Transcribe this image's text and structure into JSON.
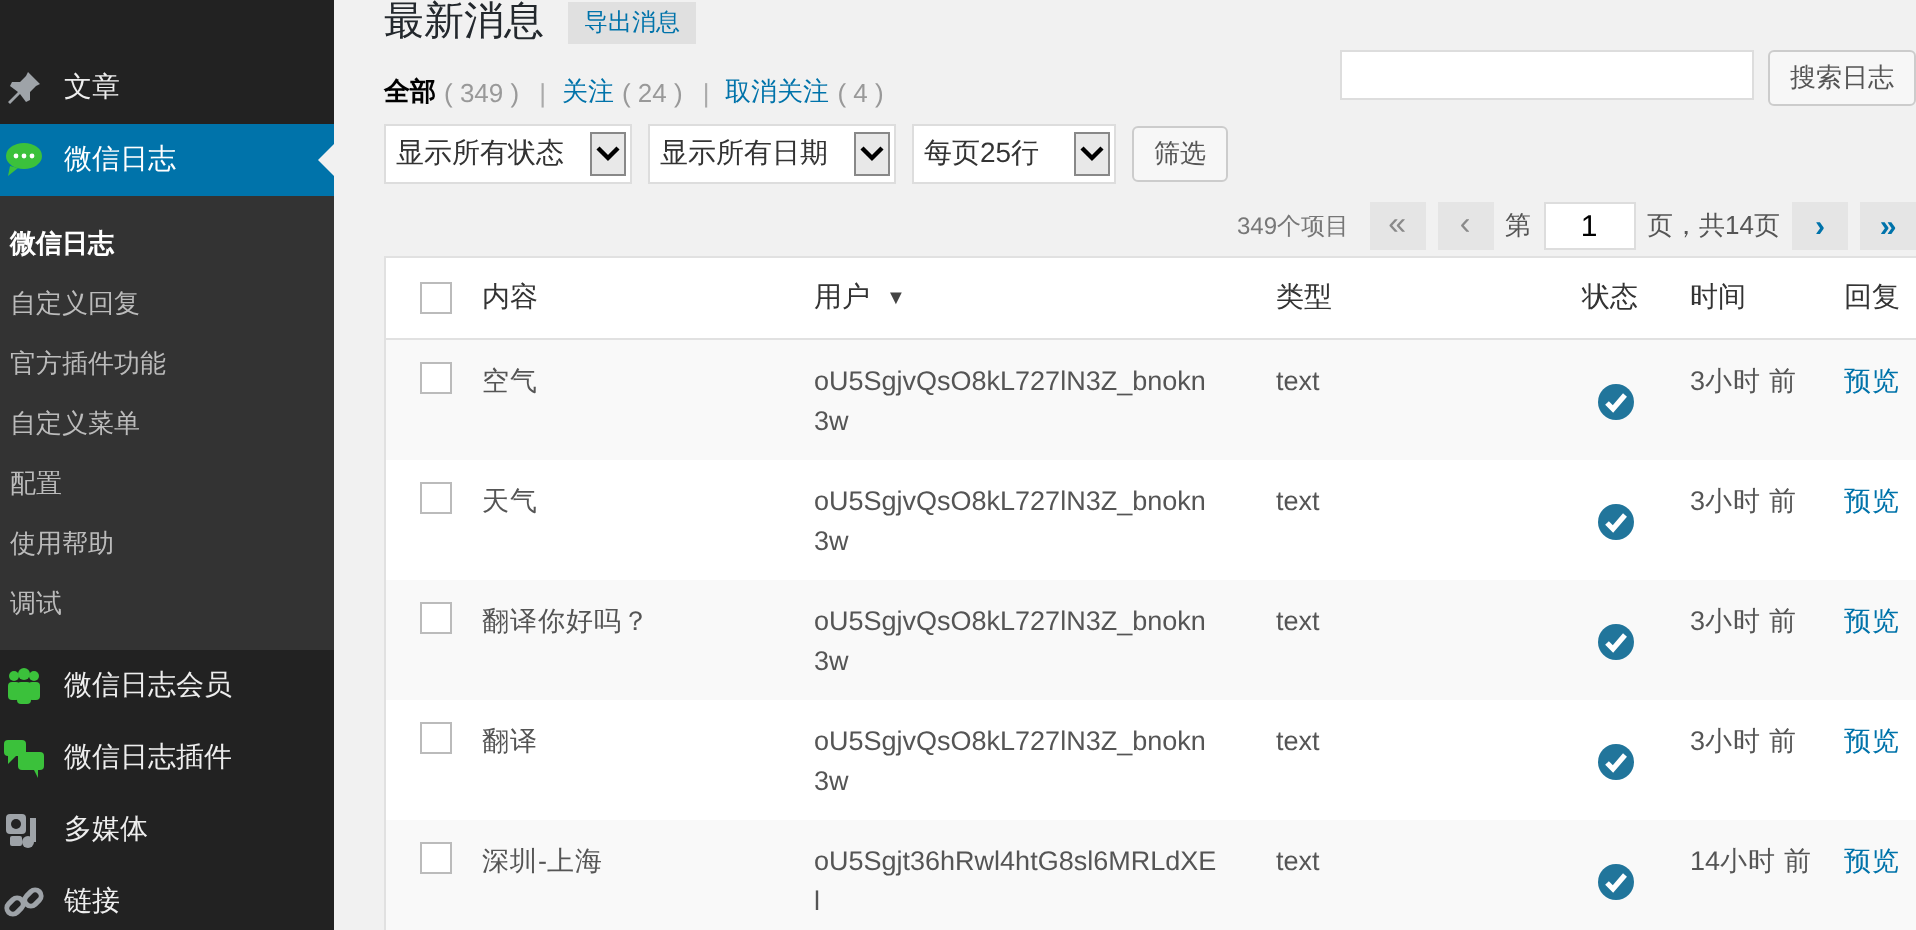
{
  "sidebar": {
    "items": [
      {
        "label": "文章",
        "selected": false
      },
      {
        "label": "微信日志",
        "selected": true,
        "children": [
          {
            "label": "微信日志",
            "selected": true
          },
          {
            "label": "自定义回复",
            "selected": false
          },
          {
            "label": "官方插件功能",
            "selected": false
          },
          {
            "label": "自定义菜单",
            "selected": false
          },
          {
            "label": "配置",
            "selected": false
          },
          {
            "label": "使用帮助",
            "selected": false
          },
          {
            "label": "调试",
            "selected": false
          }
        ]
      },
      {
        "label": "微信日志会员",
        "selected": false
      },
      {
        "label": "微信日志插件",
        "selected": false
      },
      {
        "label": "多媒体",
        "selected": false
      },
      {
        "label": "链接",
        "selected": false
      }
    ]
  },
  "page": {
    "title": "最新消息",
    "export_button": "导出消息"
  },
  "views": {
    "separator": "|",
    "items": [
      {
        "label": "全部",
        "count": "( 349 )",
        "selected": true
      },
      {
        "label": "关注",
        "count": "( 24 )",
        "selected": false
      },
      {
        "label": "取消关注",
        "count": "( 4 )",
        "selected": false
      }
    ]
  },
  "search": {
    "button": "搜索日志"
  },
  "filters": {
    "dropdowns": [
      {
        "value": "显示所有状态"
      },
      {
        "value": "显示所有日期"
      },
      {
        "value": "每页25行"
      }
    ],
    "button": "筛选"
  },
  "pagination": {
    "total": "349个项目",
    "first": {
      "label": "«",
      "disabled": true
    },
    "prev": {
      "label": "‹",
      "disabled": true
    },
    "page_prefix": "第",
    "current_page": "1",
    "page_suffix": "页，共14页",
    "next": {
      "label": "›",
      "disabled": false
    },
    "last": {
      "label": "»",
      "disabled": false
    }
  },
  "table": {
    "select_all": {
      "checked": false
    },
    "columns": [
      {
        "label": "内容"
      },
      {
        "label": "用户",
        "sort_mark": "▼"
      },
      {
        "label": "类型"
      },
      {
        "label": "状态"
      },
      {
        "label": "时间"
      },
      {
        "label": "回复"
      }
    ],
    "rows": [
      {
        "checked": false,
        "content": "空气",
        "user": "oU5SgjvQsO8kL727lN3Z_bnokn3w",
        "type": "text",
        "approved": true,
        "time": "3小时 前",
        "action": "预览"
      },
      {
        "checked": false,
        "content": "天气",
        "user": "oU5SgjvQsO8kL727lN3Z_bnokn3w",
        "type": "text",
        "approved": true,
        "time": "3小时 前",
        "action": "预览"
      },
      {
        "checked": false,
        "content": "翻译你好吗？",
        "user": "oU5SgjvQsO8kL727lN3Z_bnokn3w",
        "type": "text",
        "approved": true,
        "time": "3小时 前",
        "action": "预览"
      },
      {
        "checked": false,
        "content": "翻译",
        "user": "oU5SgjvQsO8kL727lN3Z_bnokn3w",
        "type": "text",
        "approved": true,
        "time": "3小时 前",
        "action": "预览"
      },
      {
        "checked": false,
        "content": "深圳-上海",
        "user": "oU5Sgjt36hRwl4htG8sl6MRLdXEl",
        "type": "text",
        "approved": true,
        "time": "14小时 前",
        "action": "预览"
      }
    ]
  }
}
